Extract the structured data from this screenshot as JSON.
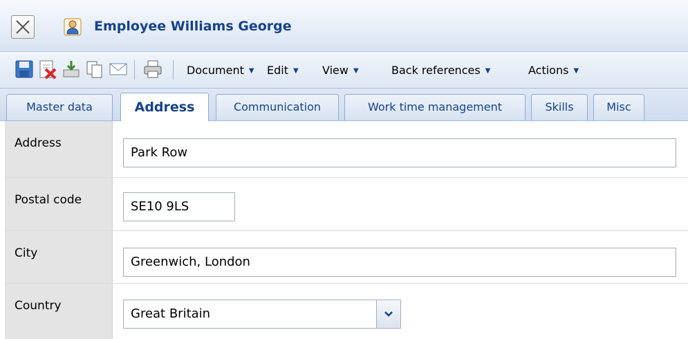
{
  "window": {
    "title": "Employee Williams George",
    "close_icon": "close-x-icon",
    "record_icon": "employee-icon"
  },
  "toolbar": {
    "icons": [
      "save-icon",
      "delete-icon",
      "export-icon",
      "copy-icon",
      "email-icon",
      "print-icon"
    ],
    "menus": [
      {
        "label": "Document"
      },
      {
        "label": "Edit"
      },
      {
        "label": "View"
      },
      {
        "label": "Back references"
      },
      {
        "label": "Actions"
      }
    ]
  },
  "tabs": [
    {
      "label": "Master data",
      "active": false
    },
    {
      "label": "Address",
      "active": true
    },
    {
      "label": "Communication",
      "active": false
    },
    {
      "label": "Work time management",
      "active": false
    },
    {
      "label": "Skills",
      "active": false
    },
    {
      "label": "Misc",
      "active": false
    }
  ],
  "form": {
    "address": {
      "label": "Address",
      "value": "Park Row"
    },
    "postal_code": {
      "label": "Postal code",
      "value": "SE10 9LS"
    },
    "city": {
      "label": "City",
      "value": "Greenwich, London"
    },
    "country": {
      "label": "Country",
      "value": "Great Britain"
    }
  },
  "colors": {
    "title_text": "#15428b",
    "accent": "#99bbe8",
    "label_bg": "#e4e4e4"
  }
}
